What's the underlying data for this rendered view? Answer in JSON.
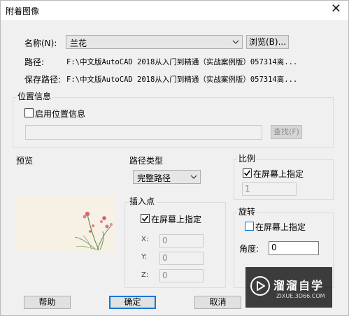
{
  "window": {
    "title": "附着图像",
    "close_glyph": "✕"
  },
  "name_row": {
    "label": "名称(N):",
    "value": "兰花",
    "browse_label": "浏览(B)..."
  },
  "path_row": {
    "label": "路径:",
    "value": "F:\\中文版AutoCAD 2018从入门到精通（实战案例版）057314离..."
  },
  "saved_path_row": {
    "label": "保存路径:",
    "value": "F:\\中文版AutoCAD 2018从入门到精通（实战案例版）057314离..."
  },
  "location": {
    "group_title": "位置信息",
    "enable_label": "启用位置信息",
    "enable_checked": false,
    "field_value": "",
    "find_label": "查找(F)"
  },
  "preview": {
    "label": "预览"
  },
  "path_type": {
    "title": "路径类型",
    "selected": "完整路径"
  },
  "insertion": {
    "title": "插入点",
    "onscreen_label": "在屏幕上指定",
    "onscreen_checked": true,
    "x_label": "X:",
    "x_value": "0",
    "y_label": "Y:",
    "y_value": "0",
    "z_label": "Z:",
    "z_value": "0"
  },
  "scale": {
    "title": "比例",
    "onscreen_label": "在屏幕上指定",
    "onscreen_checked": true,
    "value": "1"
  },
  "rotation": {
    "title": "旋转",
    "onscreen_label": "在屏幕上指定",
    "onscreen_checked": false,
    "angle_label": "角度:",
    "angle_value": "0"
  },
  "buttons": {
    "help": "帮助",
    "ok": "确定",
    "cancel": "取消"
  },
  "watermark": {
    "text": "溜溜自学",
    "url": "ZIXUE.3D66.COM"
  }
}
